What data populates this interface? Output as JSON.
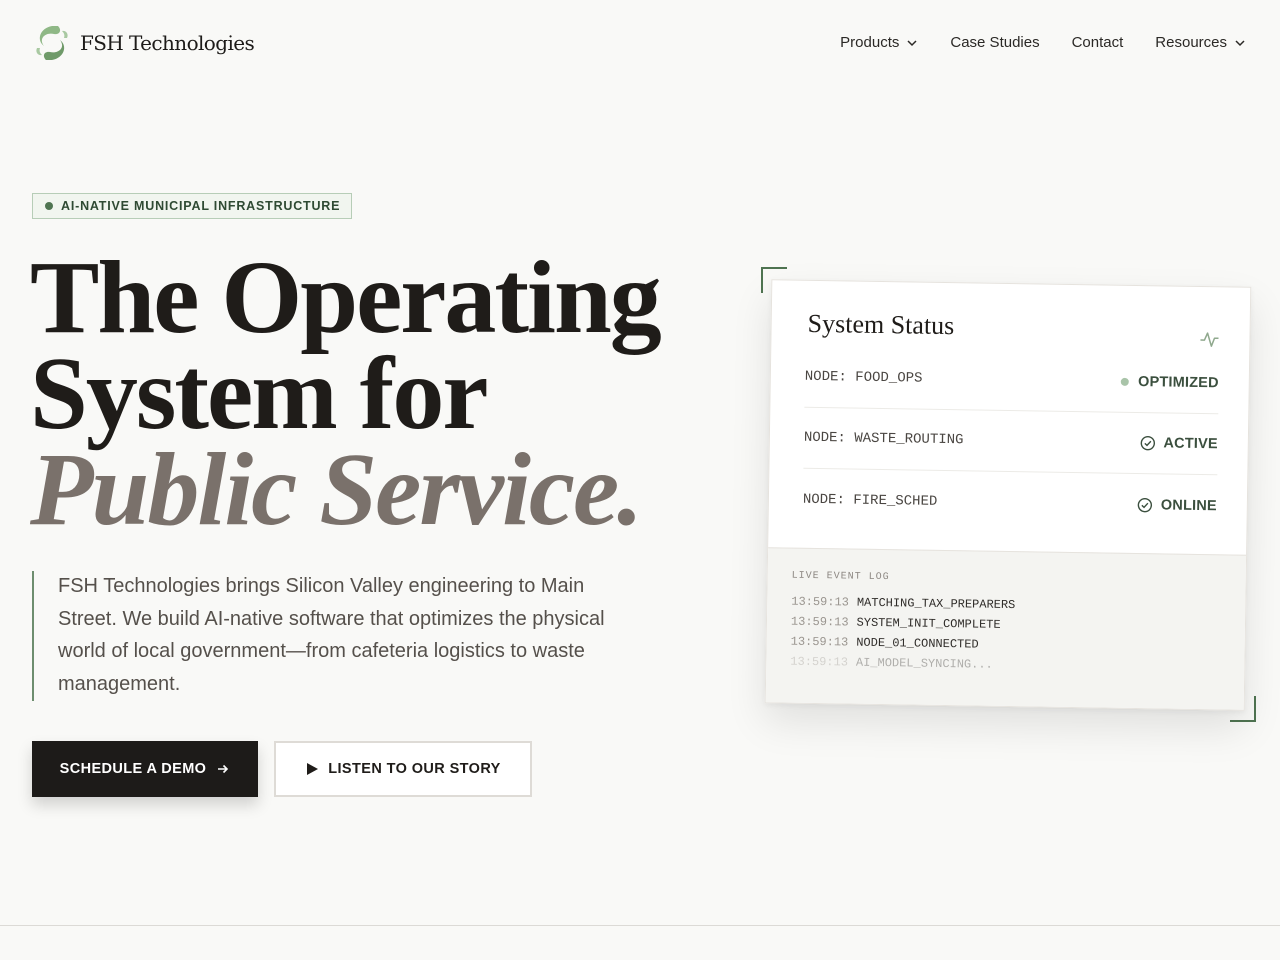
{
  "brand": {
    "name": "FSH Technologies",
    "logo_icon": "leaf-swirl-icon",
    "accent_color": "#7fa77a"
  },
  "nav": {
    "items": [
      {
        "label": "Products",
        "has_dropdown": true
      },
      {
        "label": "Case Studies",
        "has_dropdown": false
      },
      {
        "label": "Contact",
        "has_dropdown": false
      },
      {
        "label": "Resources",
        "has_dropdown": true
      }
    ]
  },
  "hero": {
    "badge": "AI-NATIVE MUNICIPAL INFRASTRUCTURE",
    "headline_line1": "The Operating",
    "headline_line2": "System for",
    "headline_line3": "Public Service.",
    "lede": "FSH Technologies brings Silicon Valley engineering to Main Street. We build AI-native software that optimizes the physical world of local government—from cafeteria logistics to waste management.",
    "primary_cta": "SCHEDULE A DEMO",
    "secondary_cta": "LISTEN TO OUR STORY"
  },
  "status_card": {
    "title": "System Status",
    "nodes": [
      {
        "label": "NODE: FOOD_OPS",
        "status": "OPTIMIZED",
        "indicator": "dot"
      },
      {
        "label": "NODE: WASTE_ROUTING",
        "status": "ACTIVE",
        "indicator": "check-circle-icon"
      },
      {
        "label": "NODE: FIRE_SCHED",
        "status": "ONLINE",
        "indicator": "check-circle-icon"
      }
    ],
    "log": {
      "heading": "LIVE EVENT LOG",
      "entries": [
        {
          "time": "13:59:13",
          "message": "MATCHING_TAX_PREPARERS"
        },
        {
          "time": "13:59:13",
          "message": "SYSTEM_INIT_COMPLETE"
        },
        {
          "time": "13:59:13",
          "message": "NODE_01_CONNECTED"
        },
        {
          "time": "13:59:13",
          "message": "AI_MODEL_SYNCING..."
        }
      ]
    }
  }
}
